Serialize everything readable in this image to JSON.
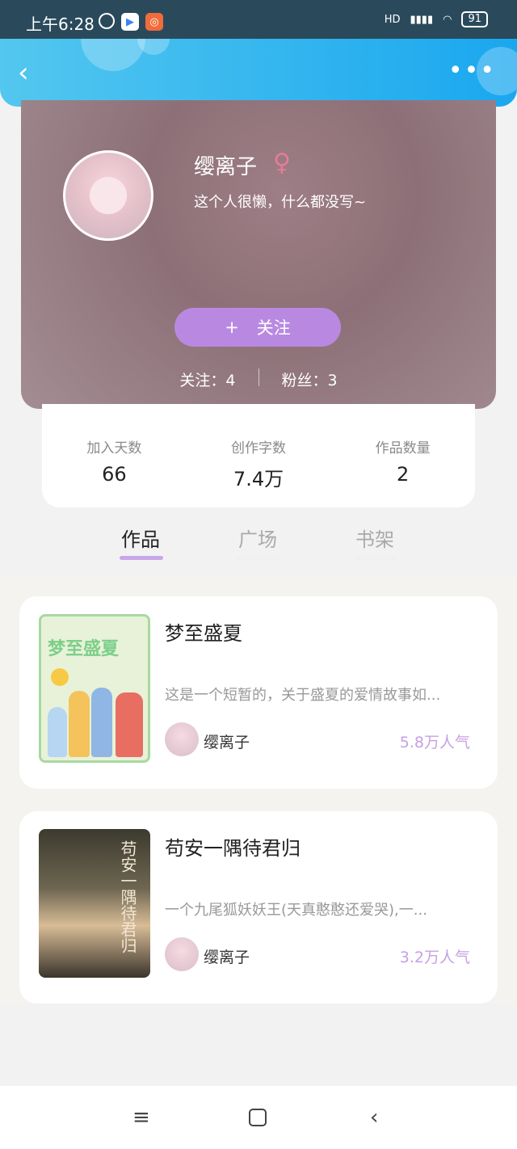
{
  "status_bar": {
    "time": "上午6:28",
    "network": "HD",
    "battery": "91"
  },
  "profile": {
    "name": "缨离子",
    "gender_symbol": "♀",
    "bio": "这个人很懒，什么都没写~",
    "follow_button_icon": "+",
    "follow_button_label": "关注",
    "following_text": "关注：4",
    "fans_text": "粉丝：3"
  },
  "stats": [
    {
      "label": "加入天数",
      "value": "66"
    },
    {
      "label": "创作字数",
      "value": "7.4万"
    },
    {
      "label": "作品数量",
      "value": "2"
    }
  ],
  "tabs": [
    {
      "label": "作品",
      "active": true
    },
    {
      "label": "广场",
      "active": false
    },
    {
      "label": "书架",
      "active": false
    }
  ],
  "works": [
    {
      "title": "梦至盛夏",
      "cover_text": "梦至盛夏",
      "description": "这是一个短暂的，关于盛夏的爱情故事如...",
      "author": "缨离子",
      "popularity": "5.8万人气"
    },
    {
      "title": "苟安一隅待君归",
      "cover_text": "苟安一隅待君归",
      "description": "一个九尾狐妖妖王(天真憨憨还爱哭),一...",
      "author": "缨离子",
      "popularity": "3.2万人气"
    }
  ],
  "colors": {
    "header_gradient_start": "#53c7ef",
    "header_gradient_end": "#1aa7ef",
    "follow_button": "#b989e2",
    "popularity": "#c7a0e4",
    "gender": "#e67b9a",
    "tab_indicator": "#c9a6ea"
  },
  "icons": {
    "back": "chevron-left-icon",
    "more": "more-dots-icon",
    "nav_menu": "menu-icon",
    "nav_home": "square-home-icon",
    "nav_back": "back-icon"
  }
}
